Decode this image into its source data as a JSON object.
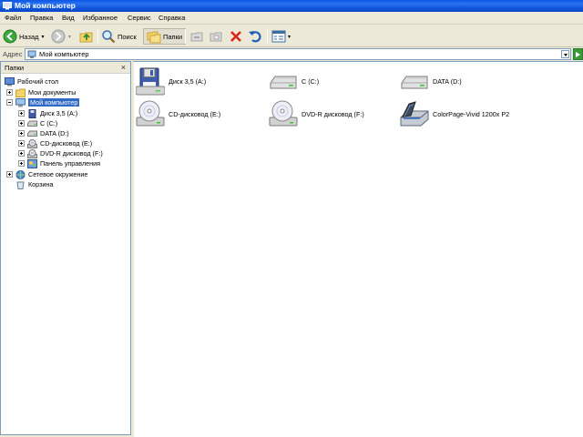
{
  "window": {
    "title": "Мой компьютер"
  },
  "menu": [
    "Файл",
    "Правка",
    "Вид",
    "Избранное",
    "Сервис",
    "Справка"
  ],
  "toolbar": {
    "back_label": "Назад",
    "search_label": "Поиск",
    "folders_label": "Папки"
  },
  "address": {
    "label": "Адрес",
    "value": "Мой компьютер"
  },
  "folders_pane": {
    "title": "Папки",
    "close_glyph": "×",
    "tree": [
      {
        "label": "Рабочий стол",
        "icon": "desktop-icon",
        "expander": "none"
      },
      {
        "label": "Мои документы",
        "icon": "folder-icon",
        "expander": "plus"
      },
      {
        "label": "Мой компьютер",
        "icon": "computer-icon",
        "expander": "minus",
        "selected": true
      },
      {
        "label": "Диск 3,5 (A:)",
        "icon": "floppy-icon",
        "expander": "plus"
      },
      {
        "label": "C (C:)",
        "icon": "hard-drive-icon",
        "expander": "plus"
      },
      {
        "label": "DATA (D:)",
        "icon": "hard-drive-icon",
        "expander": "plus"
      },
      {
        "label": "CD-дисковод (E:)",
        "icon": "cd-drive-icon",
        "expander": "plus"
      },
      {
        "label": "DVD-R дисковод (F:)",
        "icon": "dvd-drive-icon",
        "expander": "plus"
      },
      {
        "label": "Панель управления",
        "icon": "control-panel-icon",
        "expander": "plus"
      },
      {
        "label": "Сетевое окружение",
        "icon": "network-icon",
        "expander": "plus"
      },
      {
        "label": "Корзина",
        "icon": "recycle-bin-icon",
        "expander": "none"
      }
    ]
  },
  "items": [
    {
      "label": "Диск 3,5 (A:)",
      "icon": "floppy-icon"
    },
    {
      "label": "C (C:)",
      "icon": "hard-drive-icon"
    },
    {
      "label": "DATA (D:)",
      "icon": "hard-drive-icon"
    },
    {
      "label": "CD-дисковод (E:)",
      "icon": "cd-drive-icon"
    },
    {
      "label": "DVD-R дисковод (F:)",
      "icon": "dvd-drive-icon"
    },
    {
      "label": "ColorPage-Vivid 1200x P2",
      "icon": "scanner-icon"
    }
  ],
  "colors": {
    "titlebar": "#0A57E2",
    "selection": "#316AC5",
    "face": "#ECE9D8"
  }
}
